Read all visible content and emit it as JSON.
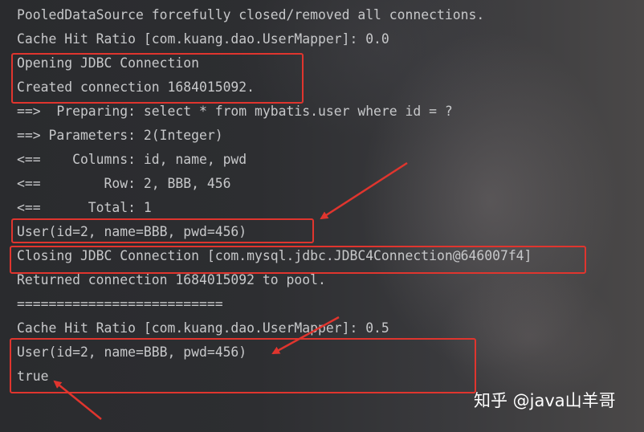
{
  "console": {
    "lines": [
      "PooledDataSource forcefully closed/removed all connections.",
      "Cache Hit Ratio [com.kuang.dao.UserMapper]: 0.0",
      "Opening JDBC Connection",
      "Created connection 1684015092.",
      "==>  Preparing: select * from mybatis.user where id = ?",
      "==> Parameters: 2(Integer)",
      "<==    Columns: id, name, pwd",
      "<==        Row: 2, BBB, 456",
      "<==      Total: 1",
      "User(id=2, name=BBB, pwd=456)",
      "Closing JDBC Connection [com.mysql.jdbc.JDBC4Connection@646007f4]",
      "Returned connection 1684015092 to pool.",
      "==========================",
      "Cache Hit Ratio [com.kuang.dao.UserMapper]: 0.5",
      "User(id=2, name=BBB, pwd=456)",
      "true"
    ]
  },
  "annotation_color": "#e0352e",
  "watermark": "知乎 @java山羊哥"
}
